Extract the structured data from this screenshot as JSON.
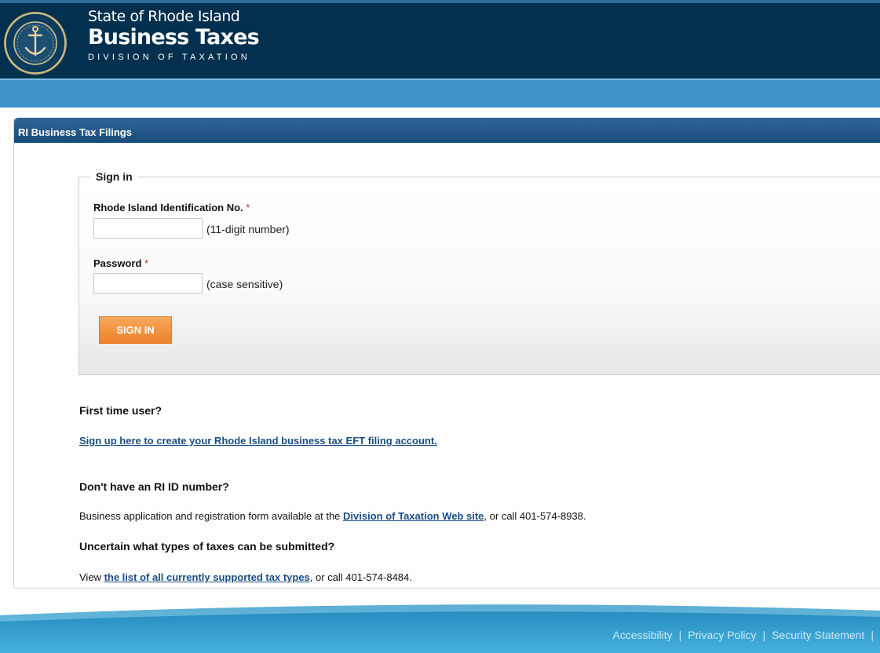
{
  "header": {
    "state": "State of Rhode Island",
    "title": "Business Taxes",
    "division": "DIVISION OF TAXATION",
    "logo_icon": "state-seal-icon",
    "bg_color": "#03304f"
  },
  "panel": {
    "title": "RI Business Tax Filings"
  },
  "signin": {
    "legend": "Sign in",
    "id_label": "Rhode Island Identification No.",
    "id_value": "",
    "id_hint": "(11-digit number)",
    "password_label": "Password",
    "password_value": "",
    "password_hint": "(case sensitive)",
    "required_mark": "*",
    "button_label": "SIGN IN",
    "button_color": "#ec812a"
  },
  "info": {
    "first_time_heading": "First time user?",
    "signup_link": "Sign up here to create your Rhode Island business tax EFT filing account.",
    "no_id_heading": "Don't have an RI ID number?",
    "no_id_text_before": "Business application and registration form available at the ",
    "no_id_link": "Division of Taxation Web site",
    "no_id_text_after": ", or call 401-574-8938.",
    "uncertain_heading": "Uncertain what types of taxes can be submitted?",
    "uncertain_text_before": "View ",
    "uncertain_link": "the list of all currently supported tax types",
    "uncertain_text_after": ", or call 401-574-8484.",
    "link_color": "#1a4d85"
  },
  "footer": {
    "links": [
      "Accessibility",
      "Privacy Policy",
      "Security Statement"
    ],
    "separator": "|"
  }
}
